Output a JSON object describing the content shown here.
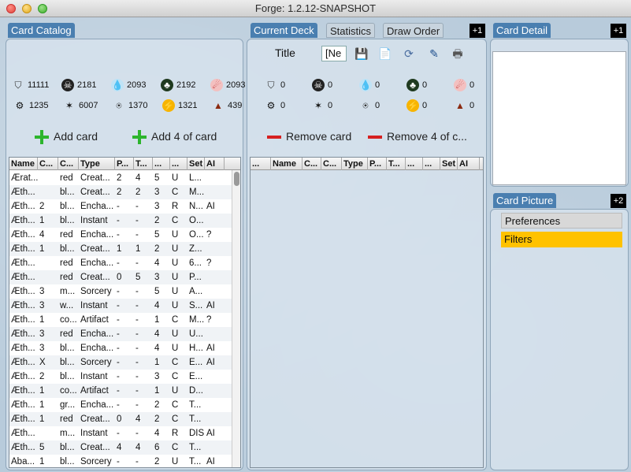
{
  "window": {
    "title": "Forge: 1.2.12-SNAPSHOT"
  },
  "catalog": {
    "tab_label": "Card Catalog",
    "mana_row1": [
      {
        "icon": "land-icon",
        "glyph": "⛉",
        "cls": "ic-land",
        "count": "11111"
      },
      {
        "icon": "black-mana-icon",
        "glyph": "☠",
        "cls": "ic-black",
        "count": "2181"
      },
      {
        "icon": "blue-mana-icon",
        "glyph": "💧",
        "cls": "ic-blue",
        "count": "2093"
      },
      {
        "icon": "green-mana-icon",
        "glyph": "♣",
        "cls": "ic-green",
        "count": "2192"
      },
      {
        "icon": "red-mana-icon",
        "glyph": "☄",
        "cls": "ic-red",
        "count": "2093"
      }
    ],
    "mana_row2": [
      {
        "icon": "colorless-icon",
        "glyph": "⚙",
        "cls": "ic-white",
        "count": "1235"
      },
      {
        "icon": "white-mana-icon",
        "glyph": "✶",
        "cls": "ic-white",
        "count": "6007"
      },
      {
        "icon": "multicolor-icon",
        "glyph": "⍟",
        "cls": "ic-multi",
        "count": "1370"
      },
      {
        "icon": "energy-icon",
        "glyph": "⚡",
        "cls": "ic-energy",
        "count": "1321"
      },
      {
        "icon": "cmc-icon",
        "glyph": "▲",
        "cls": "ic-cmc",
        "count": "439"
      }
    ],
    "add_card_label": "Add card",
    "add_4_label": "Add 4 of card",
    "columns": [
      "Name",
      "C...",
      "C...",
      "Type",
      "P...",
      "T...",
      "...",
      "...",
      "Set",
      "AI"
    ],
    "rows": [
      [
        "Ærat...",
        "",
        "red",
        "Creat...",
        "2",
        "4",
        "5",
        "U",
        "L...",
        ""
      ],
      [
        "Æth...",
        "",
        "bl...",
        "Creat...",
        "2",
        "2",
        "3",
        "C",
        "M...",
        ""
      ],
      [
        "Æth...",
        "2",
        "bl...",
        "Encha...",
        "-",
        "-",
        "3",
        "R",
        "N...",
        "AI"
      ],
      [
        "Æth...",
        "1",
        "bl...",
        "Instant",
        "-",
        "-",
        "2",
        "C",
        "O...",
        ""
      ],
      [
        "Æth...",
        "4",
        "red",
        "Encha...",
        "-",
        "-",
        "5",
        "U",
        "O...",
        "?"
      ],
      [
        "Æth...",
        "1",
        "bl...",
        "Creat...",
        "1",
        "1",
        "2",
        "U",
        "Z...",
        ""
      ],
      [
        "Æth...",
        "",
        "red",
        "Encha...",
        "-",
        "-",
        "4",
        "U",
        "6...",
        "?"
      ],
      [
        "Æth...",
        "",
        "red",
        "Creat...",
        "0",
        "5",
        "3",
        "U",
        "P...",
        ""
      ],
      [
        "Æth...",
        "3",
        "m...",
        "Sorcery",
        "-",
        "-",
        "5",
        "U",
        "A...",
        ""
      ],
      [
        "Æth...",
        "3",
        "w...",
        "Instant",
        "-",
        "-",
        "4",
        "U",
        "S...",
        "AI"
      ],
      [
        "Æth...",
        "1",
        "co...",
        "Artifact",
        "-",
        "-",
        "1",
        "C",
        "M...",
        "?"
      ],
      [
        "Æth...",
        "3",
        "red",
        "Encha...",
        "-",
        "-",
        "4",
        "U",
        "U...",
        ""
      ],
      [
        "Æth...",
        "3",
        "bl...",
        "Encha...",
        "-",
        "-",
        "4",
        "U",
        "H...",
        "AI"
      ],
      [
        "Æth...",
        "X",
        "bl...",
        "Sorcery",
        "-",
        "-",
        "1",
        "C",
        "E...",
        "AI"
      ],
      [
        "Æth...",
        "2",
        "bl...",
        "Instant",
        "-",
        "-",
        "3",
        "C",
        "E...",
        ""
      ],
      [
        "Æth...",
        "1",
        "co...",
        "Artifact",
        "-",
        "-",
        "1",
        "U",
        "D...",
        ""
      ],
      [
        "Æth...",
        "1",
        "gr...",
        "Encha...",
        "-",
        "-",
        "2",
        "C",
        "T...",
        ""
      ],
      [
        "Æth...",
        "1",
        "red",
        "Creat...",
        "0",
        "4",
        "2",
        "C",
        "T...",
        ""
      ],
      [
        "Æth...",
        "",
        "m...",
        "Instant",
        "-",
        "-",
        "4",
        "R",
        "DIS",
        "AI"
      ],
      [
        "Æth...",
        "5",
        "bl...",
        "Creat...",
        "4",
        "4",
        "6",
        "C",
        "T...",
        ""
      ],
      [
        "Aba...",
        "1",
        "bl...",
        "Sorcery",
        "-",
        "-",
        "2",
        "U",
        "T...",
        "AI"
      ]
    ]
  },
  "deck": {
    "tabs": [
      "Current Deck",
      "Statistics",
      "Draw Order"
    ],
    "badge": "+1",
    "title_label": "Title",
    "title_value": "[Ne",
    "mana_row1": [
      {
        "icon": "land-icon",
        "glyph": "⛉",
        "cls": "ic-land",
        "count": "0"
      },
      {
        "icon": "black-mana-icon",
        "glyph": "☠",
        "cls": "ic-black",
        "count": "0"
      },
      {
        "icon": "blue-mana-icon",
        "glyph": "💧",
        "cls": "ic-blue",
        "count": "0"
      },
      {
        "icon": "green-mana-icon",
        "glyph": "♣",
        "cls": "ic-green",
        "count": "0"
      },
      {
        "icon": "red-mana-icon",
        "glyph": "☄",
        "cls": "ic-red",
        "count": "0"
      }
    ],
    "mana_row2": [
      {
        "icon": "colorless-icon",
        "glyph": "⚙",
        "cls": "ic-white",
        "count": "0"
      },
      {
        "icon": "white-mana-icon",
        "glyph": "✶",
        "cls": "ic-white",
        "count": "0"
      },
      {
        "icon": "multicolor-icon",
        "glyph": "⍟",
        "cls": "ic-multi",
        "count": "0"
      },
      {
        "icon": "energy-icon",
        "glyph": "⚡",
        "cls": "ic-energy",
        "count": "0"
      },
      {
        "icon": "cmc-icon",
        "glyph": "▲",
        "cls": "ic-cmc",
        "count": "0"
      }
    ],
    "remove_label": "Remove card",
    "remove_4_label": "Remove 4 of c...",
    "columns": [
      "...",
      "Name",
      "C...",
      "C...",
      "Type",
      "P...",
      "T...",
      "...",
      "...",
      "Set",
      "AI"
    ]
  },
  "detail": {
    "tab_label": "Card Detail",
    "badge": "+1",
    "picture_tab": "Card Picture",
    "picture_badge": "+2",
    "menu": [
      "Preferences",
      "Filters"
    ]
  },
  "colors": {
    "accent": "#4a7fb0",
    "filters_highlight": "#ffc200"
  }
}
